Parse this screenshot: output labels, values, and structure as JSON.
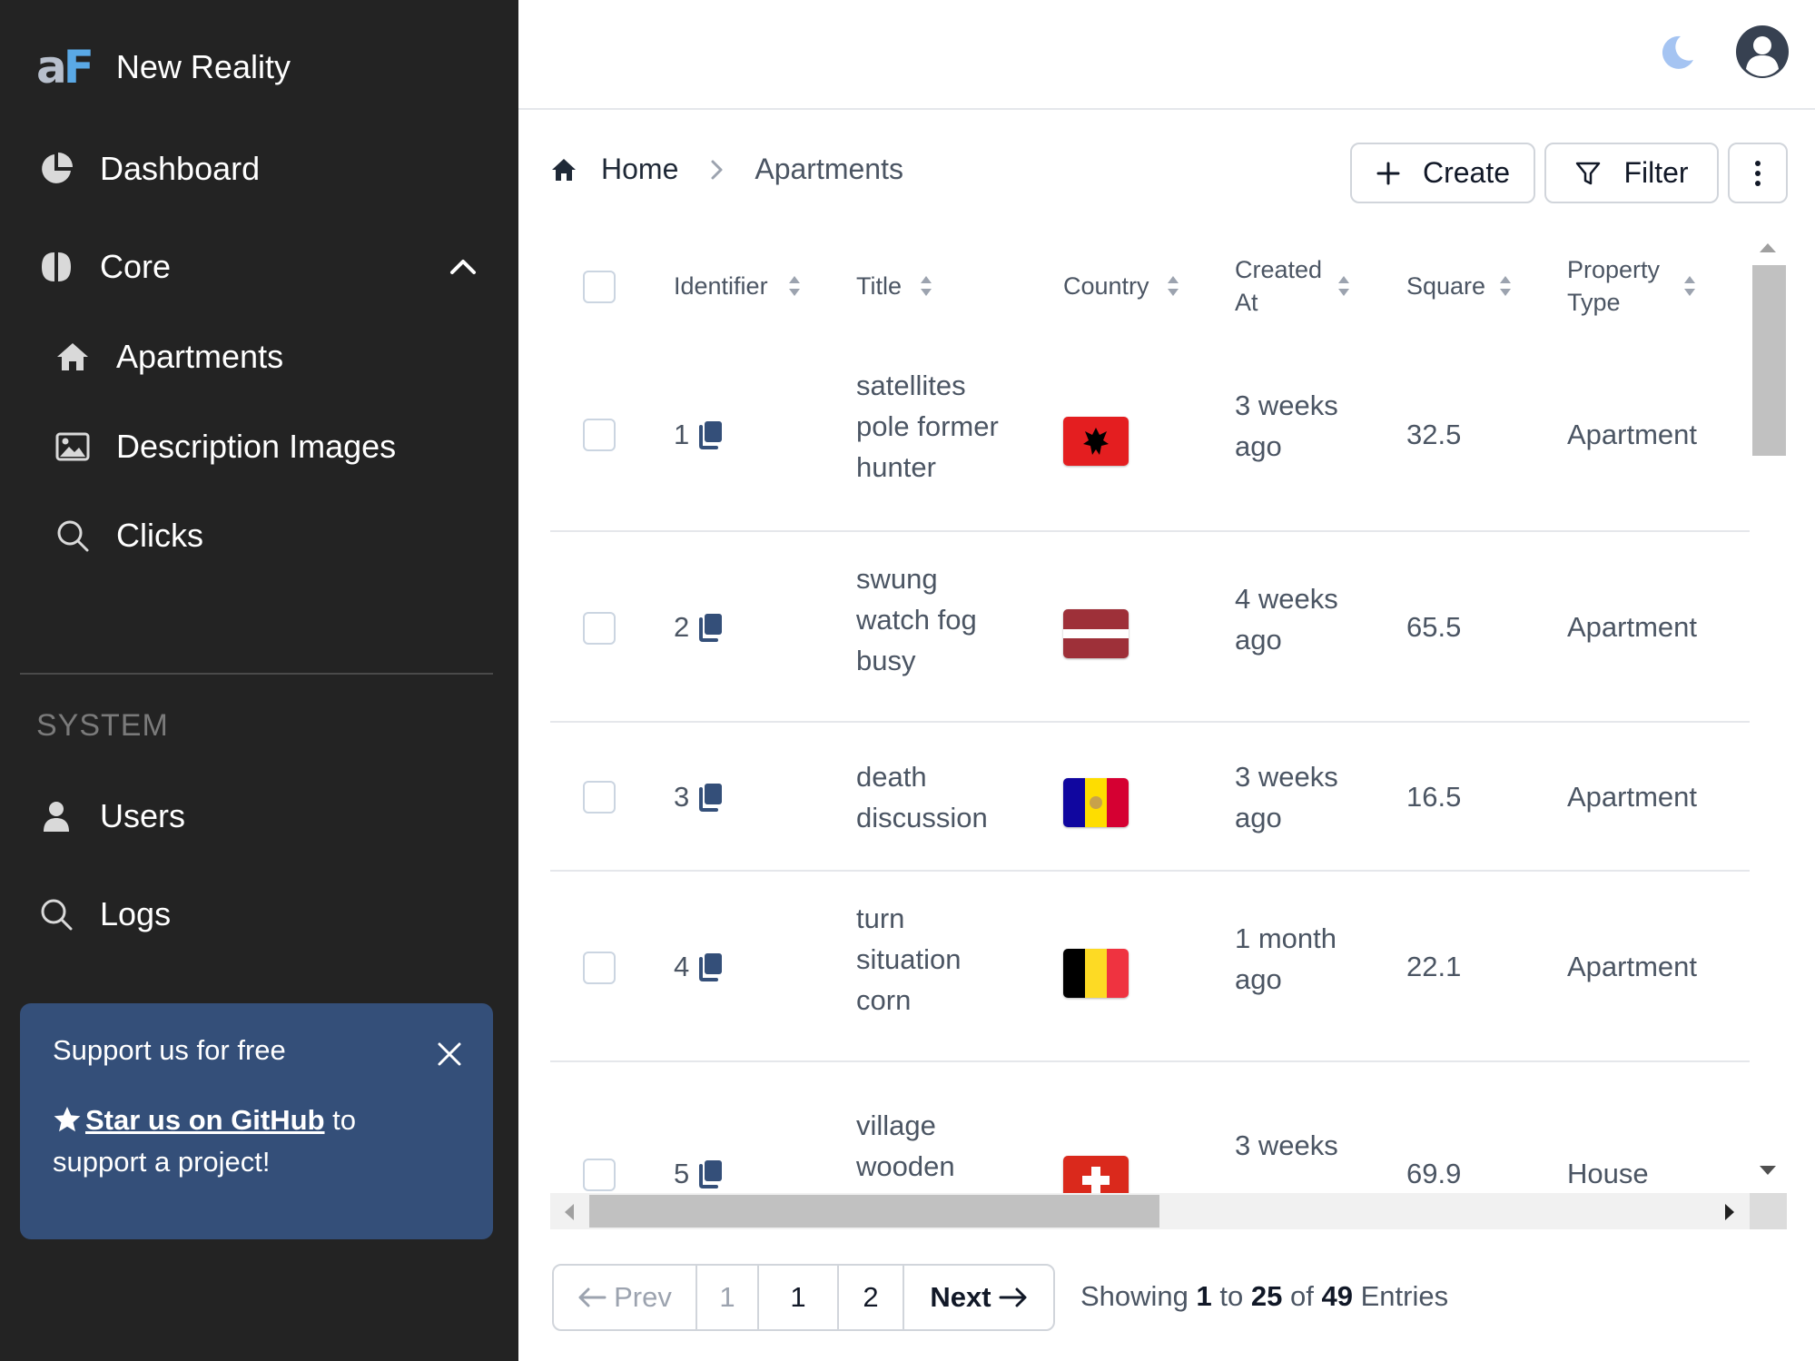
{
  "brand": {
    "logo_a": "a",
    "logo_f": "F",
    "name": "New Reality"
  },
  "sidebar": {
    "items": [
      {
        "label": "Dashboard",
        "icon": "pie-chart-icon"
      },
      {
        "label": "Core",
        "icon": "brain-icon",
        "expanded": true
      },
      {
        "label": "Apartments",
        "icon": "home-icon"
      },
      {
        "label": "Description Images",
        "icon": "image-icon"
      },
      {
        "label": "Clicks",
        "icon": "search-icon"
      }
    ],
    "section_label": "SYSTEM",
    "system_items": [
      {
        "label": "Users",
        "icon": "user-icon"
      },
      {
        "label": "Logs",
        "icon": "search-icon"
      }
    ],
    "promo": {
      "title": "Support us for free",
      "link": "Star us on GitHub",
      "text_after_link": " to",
      "text_line2": "support a project!"
    }
  },
  "breadcrumb": {
    "home": "Home",
    "current": "Apartments"
  },
  "toolbar": {
    "create_label": "Create",
    "filter_label": "Filter"
  },
  "table": {
    "columns": [
      "Identifier",
      "Title",
      "Country",
      "Created At",
      "Square",
      "Property Type"
    ],
    "column_lines": {
      "created_at": [
        "Created",
        "At"
      ],
      "property_type": [
        "Property",
        "Type"
      ]
    },
    "rows": [
      {
        "id": "1",
        "title": [
          "satellites",
          "pole former",
          "hunter"
        ],
        "country": "albania",
        "created": [
          "3 weeks",
          "ago"
        ],
        "square": "32.5",
        "type": "Apartment"
      },
      {
        "id": "2",
        "title": [
          "swung",
          "watch fog",
          "busy"
        ],
        "country": "latvia",
        "created": [
          "4 weeks",
          "ago"
        ],
        "square": "65.5",
        "type": "Apartment"
      },
      {
        "id": "3",
        "title": [
          "death",
          "discussion"
        ],
        "country": "andorra",
        "created": [
          "3 weeks",
          "ago"
        ],
        "square": "16.5",
        "type": "Apartment"
      },
      {
        "id": "4",
        "title": [
          "turn",
          "situation",
          "corn"
        ],
        "country": "belgium",
        "created": [
          "1 month",
          "ago"
        ],
        "square": "22.1",
        "type": "Apartment"
      },
      {
        "id": "5",
        "title": [
          "village",
          "wooden"
        ],
        "country": "switzerland",
        "created": [
          "3 weeks"
        ],
        "square": "69.9",
        "type": "House"
      }
    ]
  },
  "pagination": {
    "prev": "Prev",
    "pages": [
      "1",
      "1",
      "2"
    ],
    "next": "Next",
    "showing_prefix": "Showing",
    "from": "1",
    "to_word": "to",
    "to": "25",
    "of_word": "of",
    "total": "49",
    "entries_word": "Entries"
  },
  "colors": {
    "sidebar_bg": "#232323",
    "promo_bg": "#344f79",
    "logo_accent": "#5aa9e6",
    "moon": "#a5c4f2",
    "icon_dark": "#344f79"
  }
}
